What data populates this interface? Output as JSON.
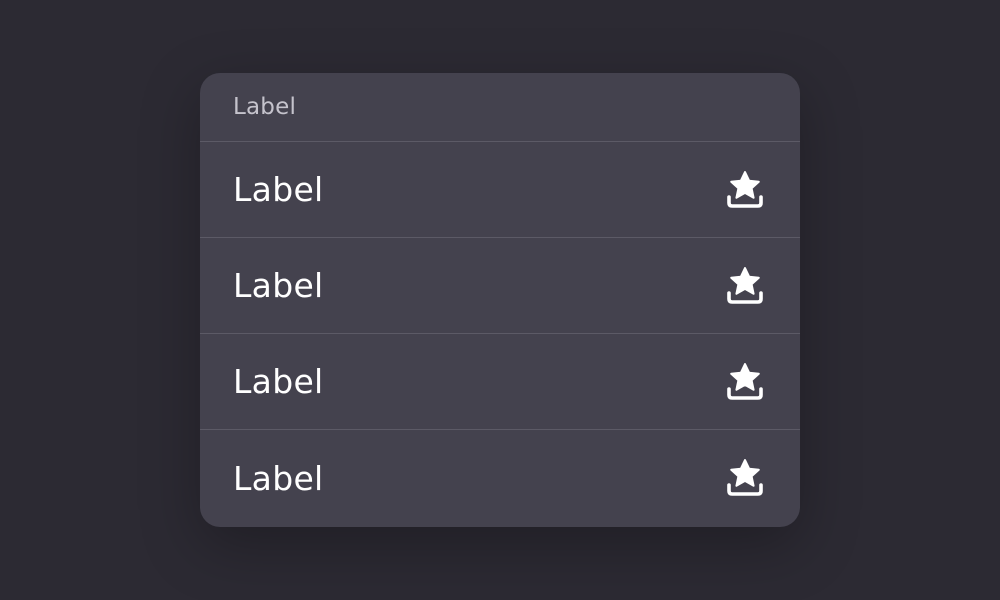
{
  "menu": {
    "header": {
      "label": "Label"
    },
    "items": [
      {
        "label": "Label",
        "icon": "star-tray-icon"
      },
      {
        "label": "Label",
        "icon": "star-tray-icon"
      },
      {
        "label": "Label",
        "icon": "star-tray-icon"
      },
      {
        "label": "Label",
        "icon": "star-tray-icon"
      }
    ]
  },
  "colors": {
    "background": "#2c2a33",
    "menu_surface": "#44424e",
    "divider": "#5c5a66",
    "header_text": "#c5c3cc",
    "item_text": "#ffffff",
    "icon": "#ffffff"
  }
}
